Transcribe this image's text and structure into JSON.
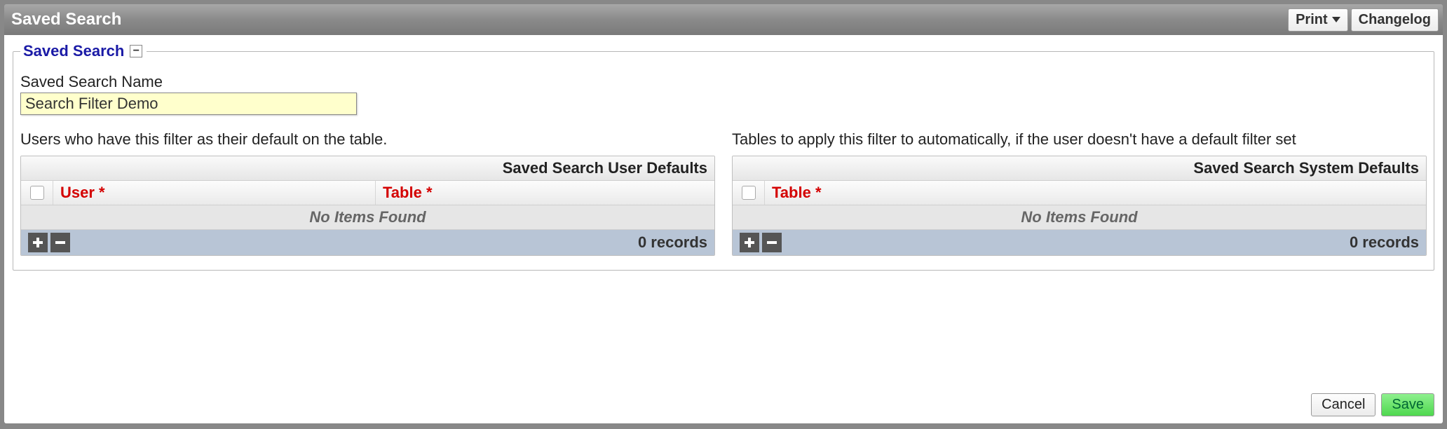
{
  "titlebar": {
    "title": "Saved Search",
    "print_label": "Print",
    "changelog_label": "Changelog"
  },
  "fieldset": {
    "legend": "Saved Search",
    "collapse_glyph": "−",
    "name_label": "Saved Search Name",
    "name_value": "Search Filter Demo"
  },
  "left": {
    "description": "Users who have this filter as their default on the table.",
    "table_title": "Saved Search User Defaults",
    "columns": [
      {
        "label": "User *"
      },
      {
        "label": "Table *"
      }
    ],
    "empty_text": "No Items Found",
    "record_count": "0 records"
  },
  "right": {
    "description": "Tables to apply this filter to automatically, if the user doesn't have a default filter set",
    "table_title": "Saved Search System Defaults",
    "columns": [
      {
        "label": "Table *"
      }
    ],
    "empty_text": "No Items Found",
    "record_count": "0 records"
  },
  "footer": {
    "cancel_label": "Cancel",
    "save_label": "Save"
  }
}
